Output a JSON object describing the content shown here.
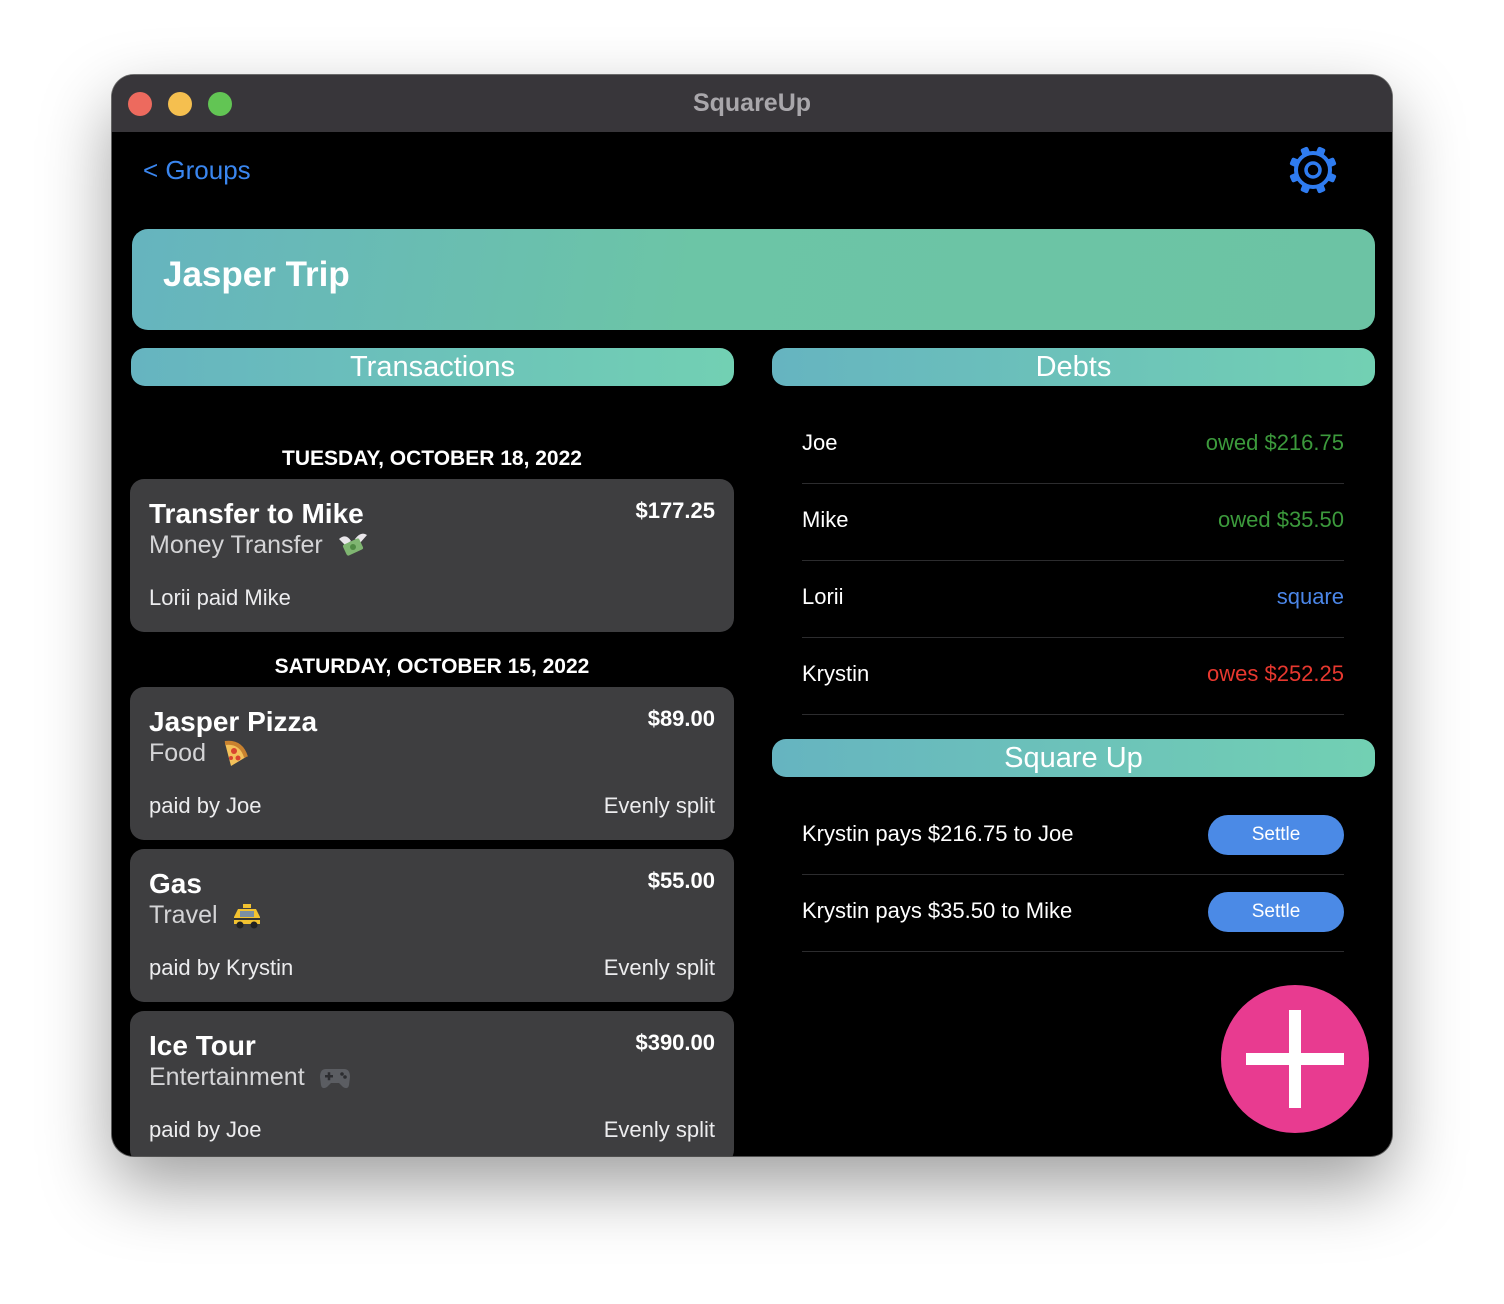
{
  "window": {
    "title": "SquareUp"
  },
  "nav": {
    "back_label": "< Groups"
  },
  "group": {
    "title": "Jasper Trip"
  },
  "sections": {
    "transactions": "Transactions",
    "debts": "Debts",
    "square_up": "Square Up"
  },
  "transactions": {
    "days": [
      {
        "date": "TUESDAY, OCTOBER 18, 2022",
        "items": [
          {
            "title": "Transfer to Mike",
            "amount": "$177.25",
            "category": "Money Transfer",
            "category_icon": "money-wings-icon",
            "paid": "Lorii paid Mike",
            "split": ""
          }
        ]
      },
      {
        "date": "SATURDAY, OCTOBER 15, 2022",
        "items": [
          {
            "title": "Jasper Pizza",
            "amount": "$89.00",
            "category": "Food",
            "category_icon": "pizza-icon",
            "paid": "paid by Joe",
            "split": "Evenly split"
          },
          {
            "title": "Gas",
            "amount": "$55.00",
            "category": "Travel",
            "category_icon": "taxi-icon",
            "paid": "paid by Krystin",
            "split": "Evenly split"
          },
          {
            "title": "Ice Tour",
            "amount": "$390.00",
            "category": "Entertainment",
            "category_icon": "game-controller-icon",
            "paid": "paid by Joe",
            "split": "Evenly split"
          }
        ]
      }
    ]
  },
  "debts": [
    {
      "name": "Joe",
      "status": "owed $216.75",
      "color": "#3c9a3c"
    },
    {
      "name": "Mike",
      "status": "owed $35.50",
      "color": "#3c9a3c"
    },
    {
      "name": "Lorii",
      "status": "square",
      "color": "#4b86e8"
    },
    {
      "name": "Krystin",
      "status": "owes $252.25",
      "color": "#e8382f"
    }
  ],
  "square_up": [
    {
      "text": "Krystin pays $216.75 to Joe",
      "button": "Settle"
    },
    {
      "text": "Krystin pays $35.50 to Mike",
      "button": "Settle"
    }
  ],
  "colors": {
    "accent": "#3a86ef",
    "card": "#3e3e40",
    "fab": "#e83b90",
    "settle": "#4b8ae6"
  },
  "icons": {
    "settings": "gear-icon",
    "add": "plus-icon"
  }
}
